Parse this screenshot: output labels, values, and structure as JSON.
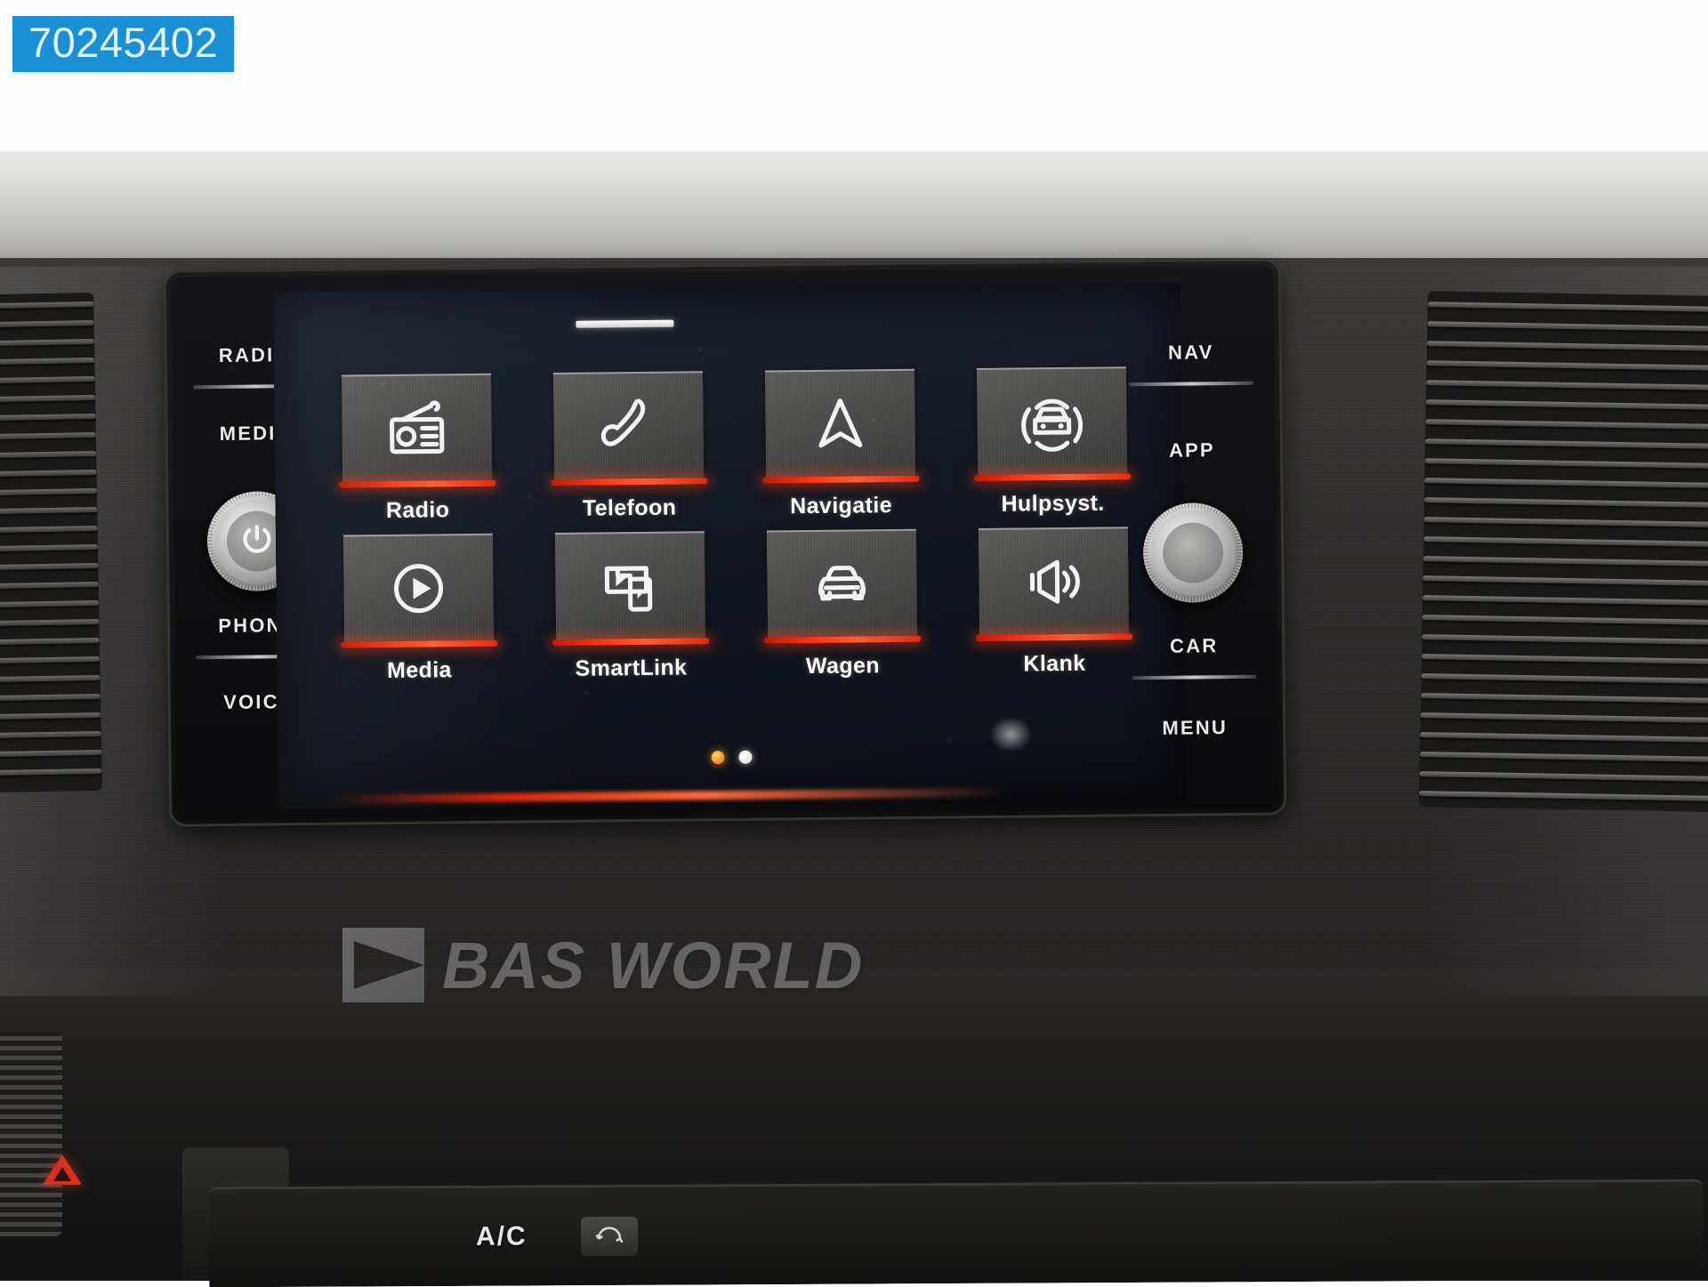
{
  "listing": {
    "badge_number": "70245402"
  },
  "head_unit": {
    "left_keys": [
      {
        "label": "RADIO"
      },
      {
        "label": "MEDIA"
      },
      {
        "label": "PHONE"
      },
      {
        "label": "VOICE"
      }
    ],
    "right_keys": [
      {
        "label": "NAV"
      },
      {
        "label": "APP"
      },
      {
        "label": "CAR"
      },
      {
        "label": "MENU"
      }
    ],
    "left_knob": {
      "name": "power-volume-knob",
      "icon": "power-icon"
    },
    "right_knob": {
      "name": "tune-knob",
      "icon": "none"
    }
  },
  "screen": {
    "menu_tiles": [
      {
        "label": "Radio",
        "icon": "radio-icon"
      },
      {
        "label": "Telefoon",
        "icon": "phone-handset-icon"
      },
      {
        "label": "Navigatie",
        "icon": "navigation-arrow-icon"
      },
      {
        "label": "Hulpsyst.",
        "icon": "parking-assist-car-icon"
      },
      {
        "label": "Media",
        "icon": "play-circle-icon"
      },
      {
        "label": "SmartLink",
        "icon": "screen-phone-mirror-icon"
      },
      {
        "label": "Wagen",
        "icon": "car-front-icon"
      },
      {
        "label": "Klank",
        "icon": "speaker-volume-icon"
      }
    ],
    "pagination": {
      "total": 2,
      "active_index": 0
    },
    "accent_color": "#ff3a18",
    "background_color": "#141821"
  },
  "watermark": {
    "text": "BAS WORLD",
    "icon": "play-logo-icon"
  },
  "climate_panel": {
    "ac_label": "A/C",
    "recirc_icon": "recirculation-icon"
  }
}
